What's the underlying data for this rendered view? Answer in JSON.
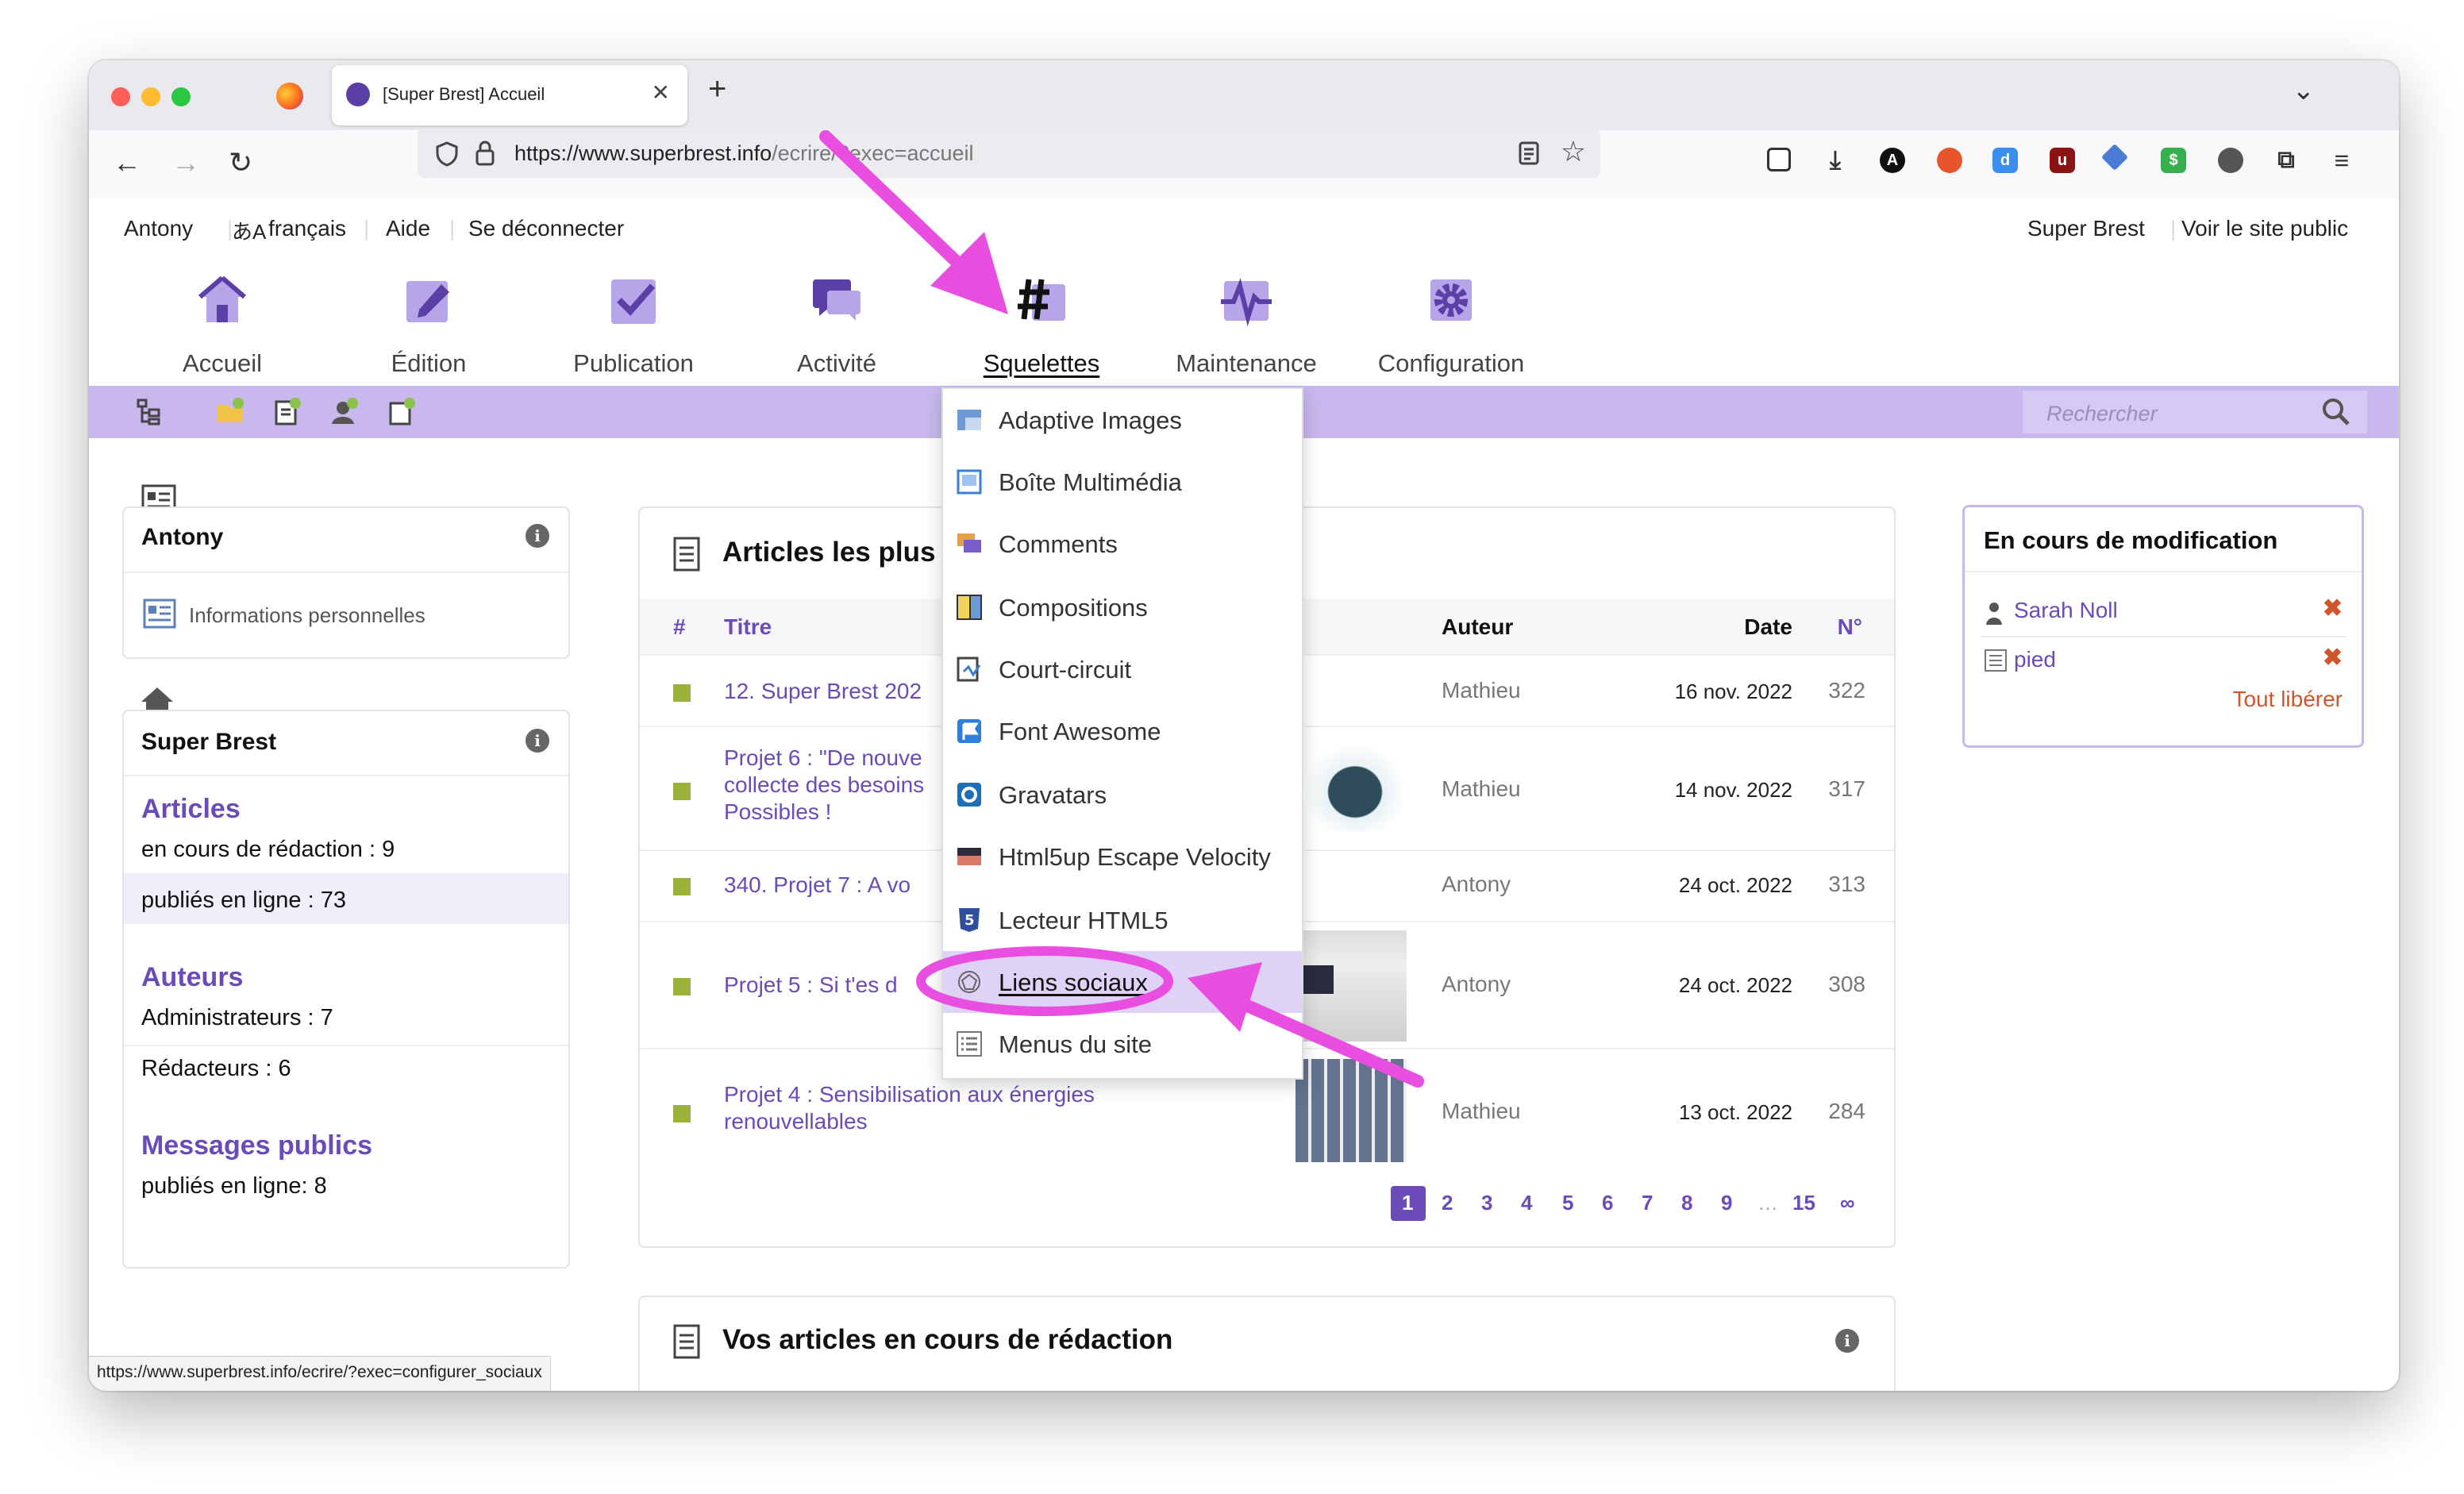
{
  "browser": {
    "tab_title": "[Super Brest] Accueil",
    "url_host": "https://www.superbrest.info",
    "url_path": "/ecrire/?exec=accueil",
    "status_url": "https://www.superbrest.info/ecrire/?exec=configurer_sociaux"
  },
  "toplinks": {
    "user": "Antony",
    "lang": "français",
    "lang_icon": "あA",
    "help": "Aide",
    "logout": "Se déconnecter",
    "site": "Super Brest",
    "public": "Voir le site public"
  },
  "menu": [
    {
      "label": "Accueil",
      "icon": "home-icon"
    },
    {
      "label": "Édition",
      "icon": "edit-icon"
    },
    {
      "label": "Publication",
      "icon": "publish-icon"
    },
    {
      "label": "Activité",
      "icon": "activity-icon"
    },
    {
      "label": "Squelettes",
      "icon": "hashtag-icon"
    },
    {
      "label": "Maintenance",
      "icon": "pulse-icon"
    },
    {
      "label": "Configuration",
      "icon": "gear-icon"
    }
  ],
  "search": {
    "placeholder": "Rechercher"
  },
  "profile": {
    "name": "Antony",
    "link": "Informations personnelles"
  },
  "site_box": {
    "title": "Super Brest",
    "articles_title": "Articles",
    "articles_draft": "en cours de rédaction : 9",
    "articles_online": "publiés en ligne : 73",
    "authors_title": "Auteurs",
    "admins": "Administrateurs : 7",
    "editors": "Rédacteurs : 6",
    "messages_title": "Messages publics",
    "messages_online": "publiés en ligne: 8"
  },
  "articles": {
    "title": "Articles les plus",
    "col_hash": "#",
    "col_title": "Titre",
    "col_author": "Auteur",
    "col_date": "Date",
    "col_num": "N°",
    "rows": [
      {
        "title": "12. Super Brest 202",
        "author": "Mathieu",
        "date": "16 nov. 2022",
        "num": "322"
      },
      {
        "title": "Projet 6 : \"De nouve\ncollecte des besoins\nPossibles !",
        "author": "Mathieu",
        "date": "14 nov. 2022",
        "num": "317"
      },
      {
        "title": "340. Projet 7 : A vo",
        "author": "Antony",
        "date": "24 oct. 2022",
        "num": "313"
      },
      {
        "title": "Projet 5 : Si t'es d",
        "author": "Antony",
        "date": "24 oct. 2022",
        "num": "308"
      },
      {
        "title": "Projet 4 : Sensibilisation aux énergies\nrenouvellables",
        "author": "Mathieu",
        "date": "13 oct. 2022",
        "num": "284"
      }
    ],
    "pages": [
      "1",
      "2",
      "3",
      "4",
      "5",
      "6",
      "7",
      "8",
      "9",
      "…",
      "15",
      "∞"
    ]
  },
  "drafts": {
    "title": "Vos articles en cours de rédaction"
  },
  "editing": {
    "title": "En cours de modification",
    "items": [
      "Sarah Noll",
      "pied"
    ],
    "release_all": "Tout libérer"
  },
  "dropdown": [
    "Adaptive Images",
    "Boîte Multimédia",
    "Comments",
    "Compositions",
    "Court-circuit",
    "Font Awesome",
    "Gravatars",
    "Html5up Escape Velocity",
    "Lecteur HTML5",
    "Liens sociaux",
    "Menus du site"
  ],
  "colors": {
    "accent": "#6a4bb8",
    "strip": "#c8b8ee",
    "annotation": "#e84ee0",
    "status_green": "#99b33a",
    "close_red": "#d2542a"
  }
}
